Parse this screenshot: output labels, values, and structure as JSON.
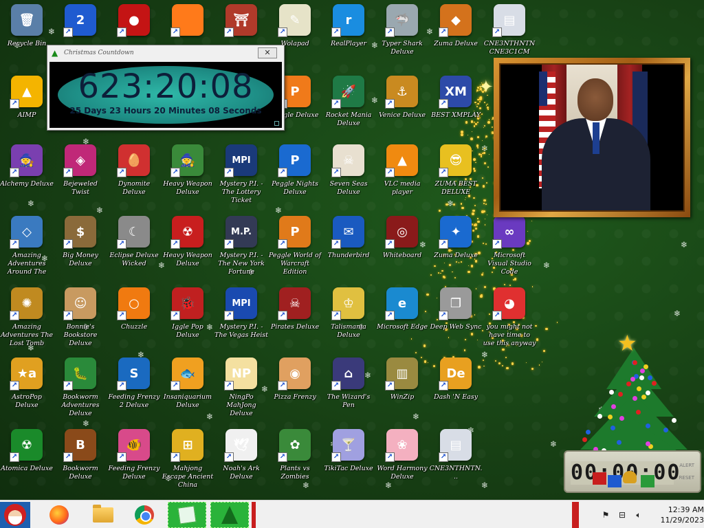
{
  "desktop": {
    "icons": [
      {
        "label": "Recycle Bin",
        "color": "#5a7fa8",
        "glyph": "🗑",
        "shortcut": false,
        "col": 0,
        "row": 0
      },
      {
        "label": "",
        "color": "#1f5bd0",
        "glyph": "2",
        "shortcut": true,
        "col": 1,
        "row": 0
      },
      {
        "label": "",
        "color": "#c41414",
        "glyph": "●",
        "shortcut": true,
        "col": 2,
        "row": 0
      },
      {
        "label": "",
        "color": "#ff7a1a",
        "glyph": "",
        "shortcut": true,
        "col": 3,
        "row": 0
      },
      {
        "label": "",
        "color": "#b03a2a",
        "glyph": "⛩",
        "shortcut": true,
        "col": 4,
        "row": 0
      },
      {
        "label": "Wolapad",
        "color": "#e6e3c8",
        "glyph": "✎",
        "shortcut": true,
        "col": 5,
        "row": 0
      },
      {
        "label": "RealPlayer",
        "color": "#1a8de0",
        "glyph": "r",
        "shortcut": true,
        "col": 6,
        "row": 0
      },
      {
        "label": "Typer Shark Deluxe",
        "color": "#9aa8b0",
        "glyph": "🦈",
        "shortcut": true,
        "col": 7,
        "row": 0
      },
      {
        "label": "Zuma Deluxe",
        "color": "#d4721c",
        "glyph": "◆",
        "shortcut": true,
        "col": 8,
        "row": 0
      },
      {
        "label": "CNE3NTHNTN CNE3C1CM",
        "color": "#d8dde6",
        "glyph": "▤",
        "shortcut": true,
        "col": 9,
        "row": 0
      },
      {
        "label": "AIMP",
        "color": "#f4b400",
        "glyph": "▲",
        "shortcut": true,
        "col": 0,
        "row": 1
      },
      {
        "label": "Peggle Deluxe",
        "color": "#f07a1a",
        "glyph": "P",
        "shortcut": true,
        "col": 5,
        "row": 1
      },
      {
        "label": "Rocket Mania Deluxe",
        "color": "#1f7a46",
        "glyph": "🚀",
        "shortcut": true,
        "col": 6,
        "row": 1
      },
      {
        "label": "Venice Deluxe",
        "color": "#c98a20",
        "glyph": "⚓",
        "shortcut": true,
        "col": 7,
        "row": 1
      },
      {
        "label": "BEST XMPLAY",
        "color": "#2d4aa8",
        "glyph": "XM",
        "shortcut": true,
        "col": 8,
        "row": 1
      },
      {
        "label": "Alchemy Deluxe",
        "color": "#7a3fb0",
        "glyph": "🧙",
        "shortcut": true,
        "col": 0,
        "row": 2
      },
      {
        "label": "Bejeweled Twist",
        "color": "#c02878",
        "glyph": "◈",
        "shortcut": true,
        "col": 1,
        "row": 2
      },
      {
        "label": "Dynomite Deluxe",
        "color": "#d03030",
        "glyph": "🥚",
        "shortcut": true,
        "col": 2,
        "row": 2
      },
      {
        "label": "Heavy Weapon Deluxe",
        "color": "#3a8a3a",
        "glyph": "🧙",
        "shortcut": true,
        "col": 3,
        "row": 2
      },
      {
        "label": "Mystery P.I. - The Lottery Ticket",
        "color": "#1a3a7a",
        "glyph": "MPI",
        "shortcut": true,
        "col": 4,
        "row": 2
      },
      {
        "label": "Peggle Nights Deluxe",
        "color": "#1a6ad0",
        "glyph": "P",
        "shortcut": true,
        "col": 5,
        "row": 2
      },
      {
        "label": "Seven Seas Deluxe",
        "color": "#e8e0d0",
        "glyph": "☠",
        "shortcut": true,
        "col": 6,
        "row": 2
      },
      {
        "label": "VLC media player",
        "color": "#f08a10",
        "glyph": "▲",
        "shortcut": true,
        "col": 7,
        "row": 2
      },
      {
        "label": "ZUMA BEST DELUXE",
        "color": "#e8c020",
        "glyph": "😎",
        "shortcut": true,
        "col": 8,
        "row": 2
      },
      {
        "label": "Amazing Adventures Around The World",
        "color": "#3a7ac0",
        "glyph": "◇",
        "shortcut": true,
        "col": 0,
        "row": 3
      },
      {
        "label": "Big Money Deluxe",
        "color": "#8a6a3a",
        "glyph": "$",
        "shortcut": true,
        "col": 1,
        "row": 3
      },
      {
        "label": "Eclipse Deluxe Wicked",
        "color": "#8a8a8a",
        "glyph": "☾",
        "shortcut": true,
        "col": 2,
        "row": 3
      },
      {
        "label": "Heavy Weapon Deluxe",
        "color": "#c81e1e",
        "glyph": "☢",
        "shortcut": true,
        "col": 3,
        "row": 3
      },
      {
        "label": "Mystery P.I. - The New York Fortune",
        "color": "#333a55",
        "glyph": "M.P.",
        "shortcut": true,
        "col": 4,
        "row": 3
      },
      {
        "label": "Peggle World of Warcraft Edition",
        "color": "#e07a1a",
        "glyph": "P",
        "shortcut": true,
        "col": 5,
        "row": 3
      },
      {
        "label": "Thunderbird",
        "color": "#1a5ac0",
        "glyph": "✉",
        "shortcut": true,
        "col": 6,
        "row": 3
      },
      {
        "label": "Whiteboard",
        "color": "#8a1a1a",
        "glyph": "◎",
        "shortcut": true,
        "col": 7,
        "row": 3
      },
      {
        "label": "Zuma Deluxe",
        "color": "#1a6ad0",
        "glyph": "✦",
        "shortcut": true,
        "col": 8,
        "row": 3
      },
      {
        "label": "Microsoft Visual Studio Code",
        "color": "#6a3ac0",
        "glyph": "∞",
        "shortcut": true,
        "col": 9,
        "row": 3
      },
      {
        "label": "Amazing Adventures The Lost Tomb",
        "color": "#c08a20",
        "glyph": "✺",
        "shortcut": true,
        "col": 0,
        "row": 4
      },
      {
        "label": "Bonnie's Bookstore Deluxe",
        "color": "#c89a60",
        "glyph": "☺",
        "shortcut": true,
        "col": 1,
        "row": 4
      },
      {
        "label": "Chuzzle",
        "color": "#f07a10",
        "glyph": "○",
        "shortcut": true,
        "col": 2,
        "row": 4
      },
      {
        "label": "Iggle Pop Deluxe",
        "color": "#c02020",
        "glyph": "🐞",
        "shortcut": true,
        "col": 3,
        "row": 4
      },
      {
        "label": "Mystery P.I. - The Vegas Heist",
        "color": "#1a4ab0",
        "glyph": "MPI",
        "shortcut": true,
        "col": 4,
        "row": 4
      },
      {
        "label": "Pirates Deluxe",
        "color": "#a02020",
        "glyph": "☠",
        "shortcut": true,
        "col": 5,
        "row": 4
      },
      {
        "label": "Talismania Deluxe",
        "color": "#e0c040",
        "glyph": "♔",
        "shortcut": true,
        "col": 6,
        "row": 4
      },
      {
        "label": "Microsoft Edge",
        "color": "#1a8ad0",
        "glyph": "e",
        "shortcut": true,
        "col": 7,
        "row": 4
      },
      {
        "label": "Deep Web Sync",
        "color": "#9a9a9a",
        "glyph": "❐",
        "shortcut": true,
        "col": 8,
        "row": 4
      },
      {
        "label": "you might not have time to use this anyway",
        "color": "#e03030",
        "glyph": "◕",
        "shortcut": true,
        "col": 9,
        "row": 4
      },
      {
        "label": "AstroPop Deluxe",
        "color": "#e0a020",
        "glyph": "★a",
        "shortcut": true,
        "col": 0,
        "row": 5
      },
      {
        "label": "Bookworm Adventures Deluxe",
        "color": "#2a8a3a",
        "glyph": "🐛",
        "shortcut": true,
        "col": 1,
        "row": 5
      },
      {
        "label": "Feeding Frenzy 2 Deluxe",
        "color": "#1a6ac0",
        "glyph": "S",
        "shortcut": true,
        "col": 2,
        "row": 5
      },
      {
        "label": "Insaniquarium Deluxe",
        "color": "#f0a020",
        "glyph": "🐟",
        "shortcut": true,
        "col": 3,
        "row": 5
      },
      {
        "label": "NingPo MahJong Deluxe",
        "color": "#f4e0a0",
        "glyph": "NP",
        "shortcut": true,
        "col": 4,
        "row": 5
      },
      {
        "label": "Pizza Frenzy",
        "color": "#e0a060",
        "glyph": "◉",
        "shortcut": true,
        "col": 5,
        "row": 5
      },
      {
        "label": "The Wizard's Pen",
        "color": "#3a3a7a",
        "glyph": "⌂",
        "shortcut": true,
        "col": 6,
        "row": 5
      },
      {
        "label": "WinZip",
        "color": "#9a8a40",
        "glyph": "▥",
        "shortcut": true,
        "col": 7,
        "row": 5
      },
      {
        "label": "Dash 'N Easy",
        "color": "#e8a020",
        "glyph": "De",
        "shortcut": true,
        "col": 8,
        "row": 5
      },
      {
        "label": "Atomica Deluxe",
        "color": "#1a8a2a",
        "glyph": "☢",
        "shortcut": true,
        "col": 0,
        "row": 6
      },
      {
        "label": "Bookworm Deluxe",
        "color": "#8a4a1a",
        "glyph": "B",
        "shortcut": true,
        "col": 1,
        "row": 6
      },
      {
        "label": "Feeding Frenzy Deluxe",
        "color": "#d84a8a",
        "glyph": "🐠",
        "shortcut": true,
        "col": 2,
        "row": 6
      },
      {
        "label": "Mahjong Escape Ancient China",
        "color": "#e0b020",
        "glyph": "⊞",
        "shortcut": true,
        "col": 3,
        "row": 6
      },
      {
        "label": "Noah's Ark Deluxe",
        "color": "#f0f0f0",
        "glyph": "🕊",
        "shortcut": true,
        "col": 4,
        "row": 6
      },
      {
        "label": "Plants vs Zombies",
        "color": "#3a8a3a",
        "glyph": "✿",
        "shortcut": true,
        "col": 5,
        "row": 6
      },
      {
        "label": "TikiTac Deluxe",
        "color": "#a0a0e0",
        "glyph": "🍸",
        "shortcut": true,
        "col": 6,
        "row": 6
      },
      {
        "label": "Word Harmony Deluxe",
        "color": "#f4b0c0",
        "glyph": "❀",
        "shortcut": true,
        "col": 7,
        "row": 6
      },
      {
        "label": "CNE3NTHNTN...",
        "color": "#d8dde6",
        "glyph": "▤",
        "shortcut": true,
        "col": 8,
        "row": 6
      }
    ]
  },
  "countdown": {
    "title": "Christmas Countdown",
    "close": "✕",
    "time": "623:20:08",
    "subtitle": "25 Days 23 Hours 20 Minutes 08 Seconds"
  },
  "digital_clock": {
    "digits": "00:00:00",
    "side_top": "ALERT",
    "side_bottom": "RESET"
  },
  "taskbar": {
    "clock_time": "12:39 AM",
    "clock_date": "11/29/2023",
    "tray": [
      "flag-icon",
      "network-icon",
      "volume-icon"
    ]
  },
  "colors": {
    "desktop_bg": "#173f14",
    "taskbar_bg": "#f0f0f0",
    "countdown_teal": "#1e8e86"
  }
}
